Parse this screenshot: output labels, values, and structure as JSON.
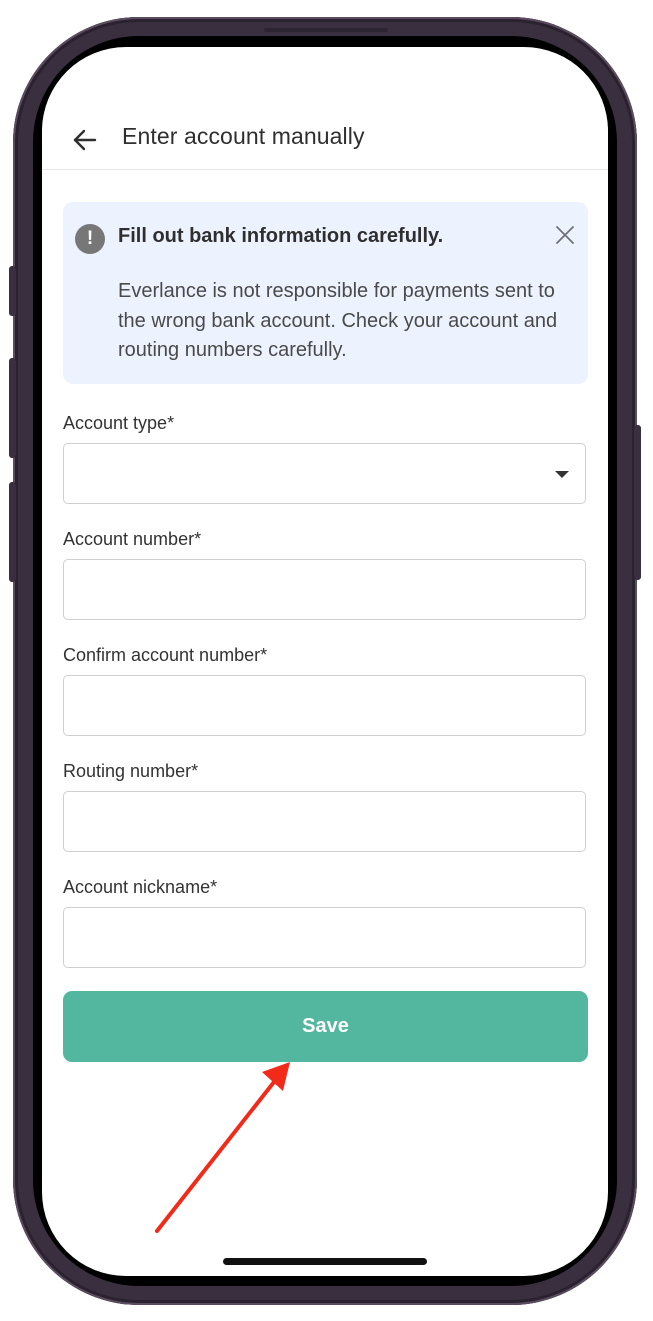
{
  "header": {
    "title": "Enter account manually",
    "back_icon": "arrow-left-icon"
  },
  "alert": {
    "icon": "exclamation-circle-icon",
    "icon_glyph": "!",
    "title": "Fill out bank information carefully.",
    "body": "Everlance is not responsible for payments sent to the wrong bank account. Check your account and routing numbers carefully.",
    "close_icon": "close-icon",
    "background_color": "#ecf3fe"
  },
  "form": {
    "account_type_label": "Account type*",
    "account_type_value": "",
    "account_number_label": "Account number*",
    "account_number_value": "",
    "confirm_account_number_label": "Confirm account number*",
    "confirm_account_number_value": "",
    "routing_number_label": "Routing number*",
    "routing_number_value": "",
    "account_nickname_label": "Account nickname*",
    "account_nickname_value": ""
  },
  "save_button": {
    "label": "Save",
    "color": "#53b7a0"
  },
  "annotation": {
    "arrow_color": "#f22a1a"
  }
}
